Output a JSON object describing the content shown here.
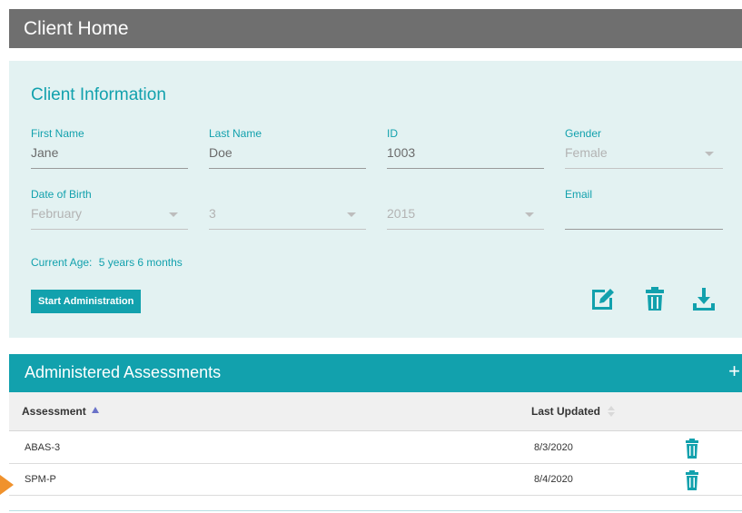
{
  "header": {
    "title": "Client Home"
  },
  "client_info": {
    "title": "Client Information",
    "first_name": {
      "label": "First Name",
      "value": "Jane"
    },
    "last_name": {
      "label": "Last Name",
      "value": "Doe"
    },
    "id": {
      "label": "ID",
      "value": "1003"
    },
    "gender": {
      "label": "Gender",
      "value": "Female"
    },
    "dob": {
      "label": "Date of Birth",
      "month": "February",
      "day": "3",
      "year": "2015"
    },
    "email": {
      "label": "Email",
      "value": ""
    },
    "current_age": {
      "label": "Current Age:",
      "value": "5 years 6 months"
    },
    "start_button": "Start Administration",
    "icons": [
      "edit-icon",
      "trash-icon",
      "download-icon"
    ]
  },
  "assessments": {
    "title": "Administered Assessments",
    "add_label": "+",
    "columns": [
      "Assessment",
      "Last Updated"
    ],
    "rows": [
      {
        "assessment": "ABAS-3",
        "last_updated": "8/3/2020"
      },
      {
        "assessment": "SPM-P",
        "last_updated": "8/4/2020"
      }
    ]
  },
  "colors": {
    "accent": "#12a1ad",
    "header_gray": "#6f6f6f",
    "panel_bg": "#e3f2f2",
    "pointer": "#f0922d",
    "sort_indicator": "#6a72c8"
  }
}
